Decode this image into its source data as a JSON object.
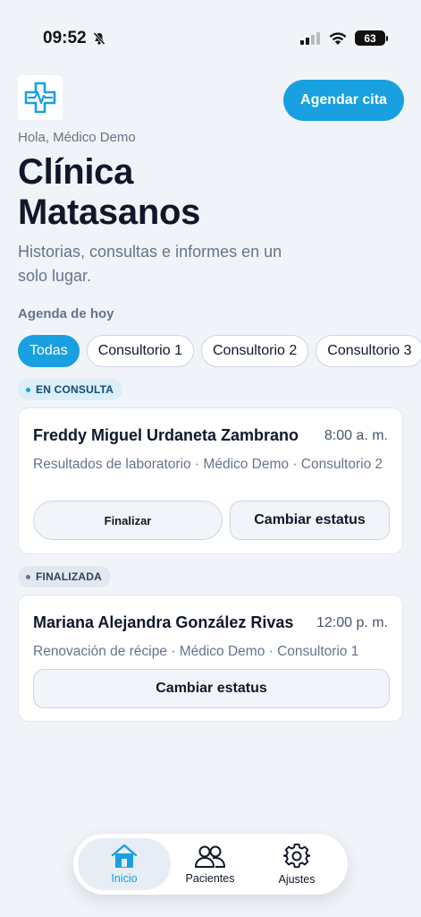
{
  "status_bar": {
    "time": "09:52",
    "battery": "63"
  },
  "header": {
    "agendar_label": "Agendar cita",
    "greeting": "Hola, Médico Demo",
    "title": "Clínica Matasanos",
    "subtitle": "Historias, consultas e informes en un solo lugar."
  },
  "agenda": {
    "label": "Agenda de hoy",
    "filters": [
      "Todas",
      "Consultorio 1",
      "Consultorio 2",
      "Consultorio 3"
    ]
  },
  "groups": [
    {
      "badge": "EN CONSULTA",
      "appointment": {
        "name": "Freddy Miguel Urdaneta Zambrano",
        "time": "8:00 a. m.",
        "detail": "Resultados de laboratorio · Médico Demo · Consultorio 2",
        "finish_label": "Finalizar",
        "status_label": "Cambiar estatus"
      }
    },
    {
      "badge": "FINALIZADA",
      "appointment": {
        "name": "Mariana Alejandra González Rivas",
        "time": "12:00 p. m.",
        "detail": "Renovación de récipe · Médico Demo · Consultorio 1",
        "status_label": "Cambiar estatus"
      }
    }
  ],
  "nav": {
    "home": "Inicio",
    "patients": "Pacientes",
    "settings": "Ajustes"
  },
  "colors": {
    "accent": "#18a0e0",
    "background": "#f0f4f8",
    "text": "#0f172a",
    "muted": "#64748b"
  },
  "icons": {
    "logo": "medical-cross-heartbeat-icon",
    "home": "home-icon",
    "patients": "users-icon",
    "settings": "gear-icon"
  }
}
